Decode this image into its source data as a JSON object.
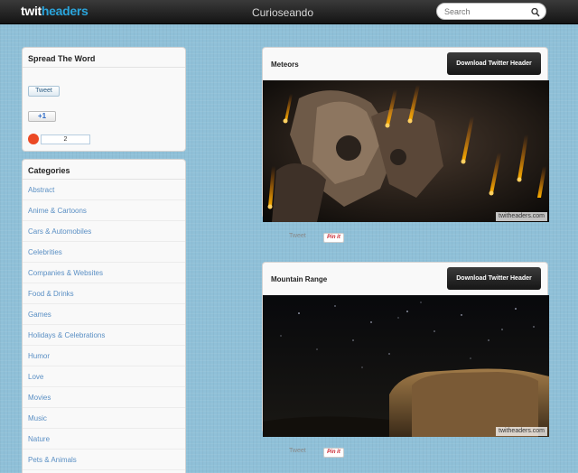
{
  "header": {
    "logo_part1": "twit",
    "logo_part2": "headers",
    "site_title": "Curioseando",
    "search_placeholder": "Search"
  },
  "spread": {
    "title": "Spread The Word",
    "tweet_label": "Tweet",
    "plusone_label": "+1",
    "stumble_count": "2"
  },
  "categories": {
    "title": "Categories",
    "items": [
      "Abstract",
      "Anime & Cartoons",
      "Cars & Automobiles",
      "Celebrities",
      "Companies & Websites",
      "Food & Drinks",
      "Games",
      "Holidays & Celebrations",
      "Humor",
      "Love",
      "Movies",
      "Music",
      "Nature",
      "Pets & Animals"
    ]
  },
  "cards": [
    {
      "title": "Meteors",
      "download_label": "Download Twitter Header",
      "watermark": "twitheaders.com",
      "tweet_label": "Tweet",
      "pin_label": "Pin it"
    },
    {
      "title": "Mountain Range",
      "download_label": "Download Twitter Header",
      "watermark": "twitheaders.com",
      "tweet_label": "Tweet",
      "pin_label": "Pin it"
    }
  ]
}
